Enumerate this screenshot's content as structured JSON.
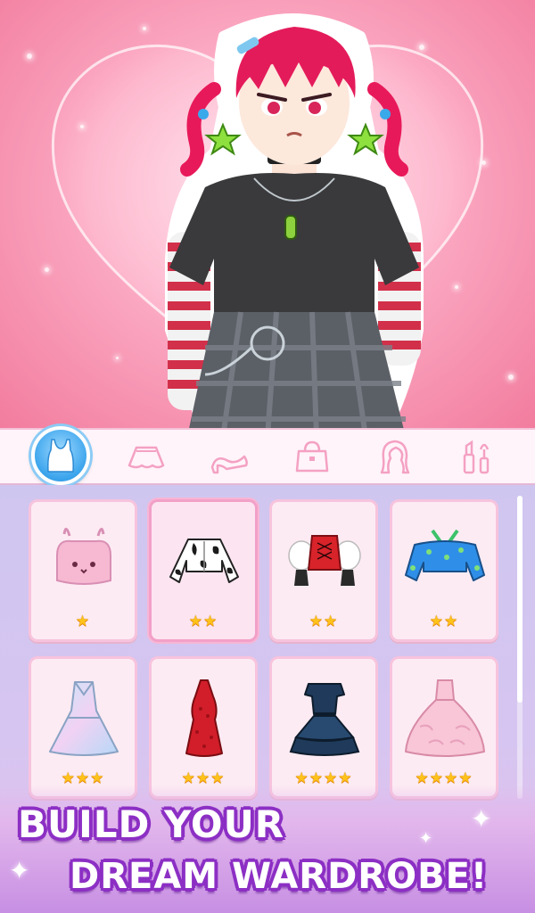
{
  "stage": {
    "background": "#fba9c3",
    "character_name": "dress-up-girl"
  },
  "tabs": [
    {
      "id": "tops",
      "icon": "tank-top-icon",
      "active": true
    },
    {
      "id": "skirts",
      "icon": "skirt-icon",
      "active": false
    },
    {
      "id": "shoes",
      "icon": "high-heel-icon",
      "active": false
    },
    {
      "id": "bags",
      "icon": "handbag-icon",
      "active": false
    },
    {
      "id": "hair",
      "icon": "hair-icon",
      "active": false
    },
    {
      "id": "makeup",
      "icon": "makeup-icon",
      "active": false
    }
  ],
  "items": [
    {
      "name": "bunny-crop-top",
      "rating": 1,
      "stars": "★",
      "color": "#f6b9d1",
      "selected": false
    },
    {
      "name": "cow-print-crop-jacket",
      "rating": 2,
      "stars": "★★",
      "color": "#ffffff",
      "selected": true
    },
    {
      "name": "red-corset-puff-sleeves",
      "rating": 2,
      "stars": "★★",
      "color": "#d8232a",
      "selected": false
    },
    {
      "name": "blue-star-off-shoulder",
      "rating": 2,
      "stars": "★★",
      "color": "#2f8fe8",
      "selected": false
    },
    {
      "name": "holographic-dress",
      "rating": 3,
      "stars": "★★★",
      "color": "#c6e6f7",
      "selected": false
    },
    {
      "name": "red-halter-dress",
      "rating": 3,
      "stars": "★★★",
      "color": "#d21e2a",
      "selected": false
    },
    {
      "name": "navy-ruffle-dress",
      "rating": 4,
      "stars": "★★★★",
      "color": "#1f3a5a",
      "selected": false
    },
    {
      "name": "pink-ball-gown",
      "rating": 4,
      "stars": "★★★★",
      "color": "#f8c6d6",
      "selected": false
    }
  ],
  "banner": {
    "line1": "BUILD YOUR",
    "line2": "DREAM WARDROBE!"
  },
  "colors": {
    "accent": "#3ba4ec",
    "tab_outline": "#f4a1c3",
    "banner_outline": "#8c2fc4",
    "star": "#ffc21a"
  }
}
